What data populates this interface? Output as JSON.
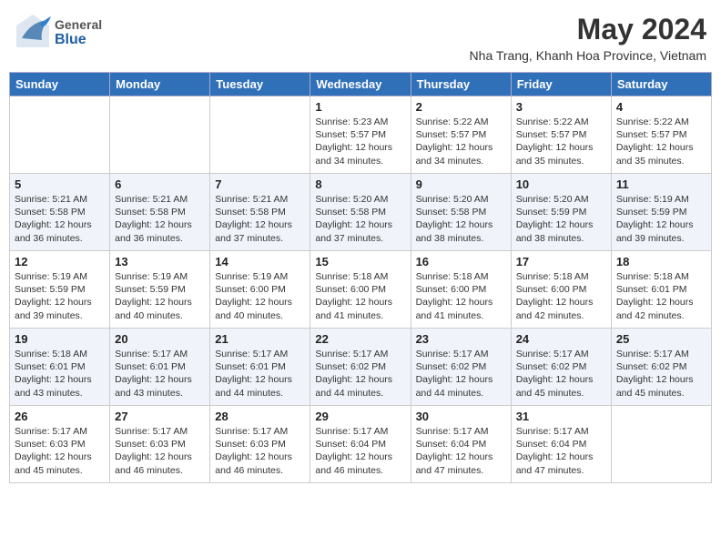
{
  "header": {
    "logo_general": "General",
    "logo_blue": "Blue",
    "month": "May 2024",
    "location": "Nha Trang, Khanh Hoa Province, Vietnam"
  },
  "days_of_week": [
    "Sunday",
    "Monday",
    "Tuesday",
    "Wednesday",
    "Thursday",
    "Friday",
    "Saturday"
  ],
  "weeks": [
    {
      "days": [
        {
          "num": "",
          "info": ""
        },
        {
          "num": "",
          "info": ""
        },
        {
          "num": "",
          "info": ""
        },
        {
          "num": "1",
          "info": "Sunrise: 5:23 AM\nSunset: 5:57 PM\nDaylight: 12 hours\nand 34 minutes."
        },
        {
          "num": "2",
          "info": "Sunrise: 5:22 AM\nSunset: 5:57 PM\nDaylight: 12 hours\nand 34 minutes."
        },
        {
          "num": "3",
          "info": "Sunrise: 5:22 AM\nSunset: 5:57 PM\nDaylight: 12 hours\nand 35 minutes."
        },
        {
          "num": "4",
          "info": "Sunrise: 5:22 AM\nSunset: 5:57 PM\nDaylight: 12 hours\nand 35 minutes."
        }
      ]
    },
    {
      "days": [
        {
          "num": "5",
          "info": "Sunrise: 5:21 AM\nSunset: 5:58 PM\nDaylight: 12 hours\nand 36 minutes."
        },
        {
          "num": "6",
          "info": "Sunrise: 5:21 AM\nSunset: 5:58 PM\nDaylight: 12 hours\nand 36 minutes."
        },
        {
          "num": "7",
          "info": "Sunrise: 5:21 AM\nSunset: 5:58 PM\nDaylight: 12 hours\nand 37 minutes."
        },
        {
          "num": "8",
          "info": "Sunrise: 5:20 AM\nSunset: 5:58 PM\nDaylight: 12 hours\nand 37 minutes."
        },
        {
          "num": "9",
          "info": "Sunrise: 5:20 AM\nSunset: 5:58 PM\nDaylight: 12 hours\nand 38 minutes."
        },
        {
          "num": "10",
          "info": "Sunrise: 5:20 AM\nSunset: 5:59 PM\nDaylight: 12 hours\nand 38 minutes."
        },
        {
          "num": "11",
          "info": "Sunrise: 5:19 AM\nSunset: 5:59 PM\nDaylight: 12 hours\nand 39 minutes."
        }
      ]
    },
    {
      "days": [
        {
          "num": "12",
          "info": "Sunrise: 5:19 AM\nSunset: 5:59 PM\nDaylight: 12 hours\nand 39 minutes."
        },
        {
          "num": "13",
          "info": "Sunrise: 5:19 AM\nSunset: 5:59 PM\nDaylight: 12 hours\nand 40 minutes."
        },
        {
          "num": "14",
          "info": "Sunrise: 5:19 AM\nSunset: 6:00 PM\nDaylight: 12 hours\nand 40 minutes."
        },
        {
          "num": "15",
          "info": "Sunrise: 5:18 AM\nSunset: 6:00 PM\nDaylight: 12 hours\nand 41 minutes."
        },
        {
          "num": "16",
          "info": "Sunrise: 5:18 AM\nSunset: 6:00 PM\nDaylight: 12 hours\nand 41 minutes."
        },
        {
          "num": "17",
          "info": "Sunrise: 5:18 AM\nSunset: 6:00 PM\nDaylight: 12 hours\nand 42 minutes."
        },
        {
          "num": "18",
          "info": "Sunrise: 5:18 AM\nSunset: 6:01 PM\nDaylight: 12 hours\nand 42 minutes."
        }
      ]
    },
    {
      "days": [
        {
          "num": "19",
          "info": "Sunrise: 5:18 AM\nSunset: 6:01 PM\nDaylight: 12 hours\nand 43 minutes."
        },
        {
          "num": "20",
          "info": "Sunrise: 5:17 AM\nSunset: 6:01 PM\nDaylight: 12 hours\nand 43 minutes."
        },
        {
          "num": "21",
          "info": "Sunrise: 5:17 AM\nSunset: 6:01 PM\nDaylight: 12 hours\nand 44 minutes."
        },
        {
          "num": "22",
          "info": "Sunrise: 5:17 AM\nSunset: 6:02 PM\nDaylight: 12 hours\nand 44 minutes."
        },
        {
          "num": "23",
          "info": "Sunrise: 5:17 AM\nSunset: 6:02 PM\nDaylight: 12 hours\nand 44 minutes."
        },
        {
          "num": "24",
          "info": "Sunrise: 5:17 AM\nSunset: 6:02 PM\nDaylight: 12 hours\nand 45 minutes."
        },
        {
          "num": "25",
          "info": "Sunrise: 5:17 AM\nSunset: 6:02 PM\nDaylight: 12 hours\nand 45 minutes."
        }
      ]
    },
    {
      "days": [
        {
          "num": "26",
          "info": "Sunrise: 5:17 AM\nSunset: 6:03 PM\nDaylight: 12 hours\nand 45 minutes."
        },
        {
          "num": "27",
          "info": "Sunrise: 5:17 AM\nSunset: 6:03 PM\nDaylight: 12 hours\nand 46 minutes."
        },
        {
          "num": "28",
          "info": "Sunrise: 5:17 AM\nSunset: 6:03 PM\nDaylight: 12 hours\nand 46 minutes."
        },
        {
          "num": "29",
          "info": "Sunrise: 5:17 AM\nSunset: 6:04 PM\nDaylight: 12 hours\nand 46 minutes."
        },
        {
          "num": "30",
          "info": "Sunrise: 5:17 AM\nSunset: 6:04 PM\nDaylight: 12 hours\nand 47 minutes."
        },
        {
          "num": "31",
          "info": "Sunrise: 5:17 AM\nSunset: 6:04 PM\nDaylight: 12 hours\nand 47 minutes."
        },
        {
          "num": "",
          "info": ""
        }
      ]
    }
  ]
}
